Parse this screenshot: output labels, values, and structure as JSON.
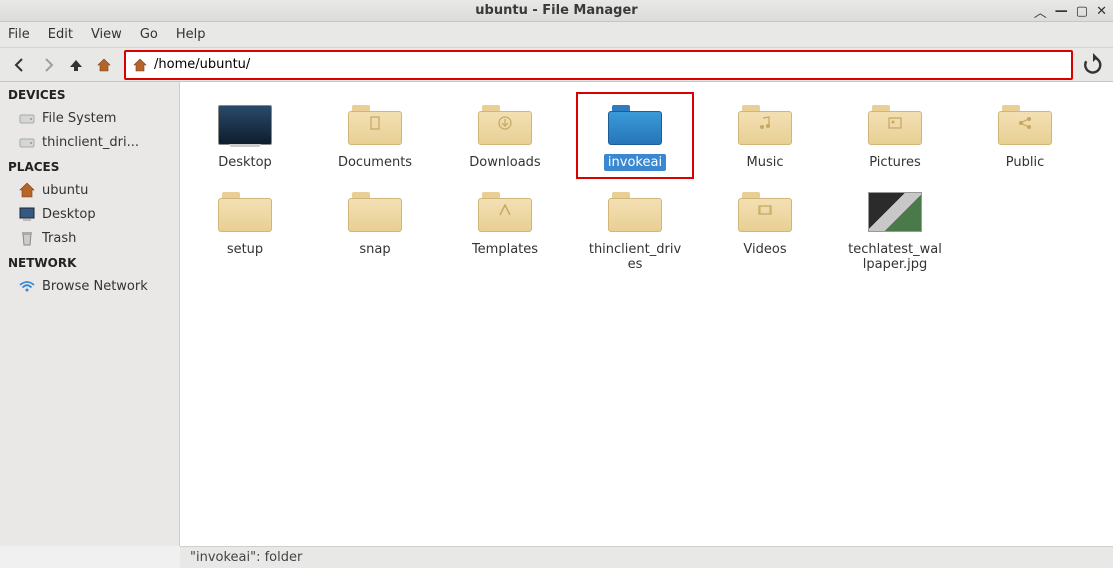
{
  "window": {
    "title": "ubuntu - File Manager"
  },
  "menu": {
    "file": "File",
    "edit": "Edit",
    "view": "View",
    "go": "Go",
    "help": "Help"
  },
  "toolbar": {
    "path": "/home/ubuntu/"
  },
  "sidebar": {
    "devices_header": "DEVICES",
    "devices": [
      {
        "label": "File System",
        "icon": "drive"
      },
      {
        "label": "thinclient_dri...",
        "icon": "drive"
      }
    ],
    "places_header": "PLACES",
    "places": [
      {
        "label": "ubuntu",
        "icon": "home"
      },
      {
        "label": "Desktop",
        "icon": "desktop"
      },
      {
        "label": "Trash",
        "icon": "trash"
      }
    ],
    "network_header": "NETWORK",
    "network": [
      {
        "label": "Browse Network",
        "icon": "wifi"
      }
    ]
  },
  "items": [
    {
      "name": "Desktop",
      "type": "desktop"
    },
    {
      "name": "Documents",
      "type": "folder",
      "emblem": "doc"
    },
    {
      "name": "Downloads",
      "type": "folder",
      "emblem": "download"
    },
    {
      "name": "invokeai",
      "type": "folder-blue",
      "selected": true,
      "highlighted": true
    },
    {
      "name": "Music",
      "type": "folder",
      "emblem": "music"
    },
    {
      "name": "Pictures",
      "type": "folder",
      "emblem": "picture"
    },
    {
      "name": "Public",
      "type": "folder",
      "emblem": "share"
    },
    {
      "name": "setup",
      "type": "folder"
    },
    {
      "name": "snap",
      "type": "folder"
    },
    {
      "name": "Templates",
      "type": "folder",
      "emblem": "template"
    },
    {
      "name": "thinclient_drives",
      "type": "folder"
    },
    {
      "name": "Videos",
      "type": "folder",
      "emblem": "video"
    },
    {
      "name": "techlatest_wallpaper.jpg",
      "type": "image"
    }
  ],
  "status": {
    "text": "\"invokeai\": folder"
  }
}
